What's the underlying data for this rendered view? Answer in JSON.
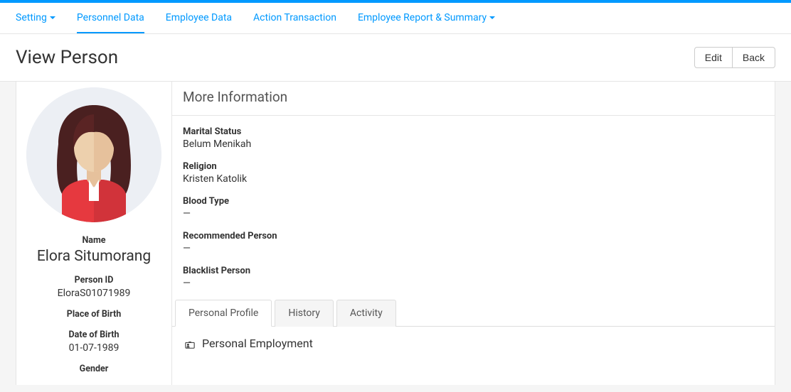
{
  "nav": {
    "items": [
      {
        "label": "Setting",
        "has_dropdown": true
      },
      {
        "label": "Personnel Data",
        "has_dropdown": false,
        "active": true
      },
      {
        "label": "Employee Data",
        "has_dropdown": false
      },
      {
        "label": "Action Transaction",
        "has_dropdown": false
      },
      {
        "label": "Employee Report & Summary",
        "has_dropdown": true
      }
    ]
  },
  "page": {
    "title": "View Person",
    "edit_label": "Edit",
    "back_label": "Back"
  },
  "sidebar": {
    "name_label": "Name",
    "name_value": "Elora Situmorang",
    "person_id_label": "Person ID",
    "person_id_value": "EloraS01071989",
    "place_of_birth_label": "Place of Birth",
    "date_of_birth_label": "Date of Birth",
    "date_of_birth_value": "01-07-1989",
    "gender_label": "Gender"
  },
  "more_info": {
    "title": "More Information",
    "marital_status_label": "Marital Status",
    "marital_status_value": "Belum Menikah",
    "religion_label": "Religion",
    "religion_value": "Kristen Katolik",
    "blood_type_label": "Blood Type",
    "blood_type_value": "—",
    "recommended_label": "Recommended Person",
    "recommended_value": "—",
    "blacklist_label": "Blacklist Person",
    "blacklist_value": "—"
  },
  "tabs": {
    "personal_profile": "Personal Profile",
    "history": "History",
    "activity": "Activity"
  },
  "section": {
    "personal_employment": "Personal Employment"
  }
}
